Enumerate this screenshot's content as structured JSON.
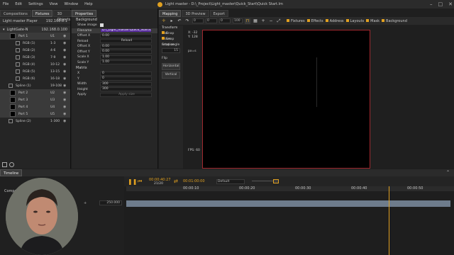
{
  "menu": [
    "File",
    "Edit",
    "Settings",
    "View",
    "Window",
    "Help"
  ],
  "window": {
    "title": "Light master - D:\\_Project\\Light_master\\Quick_Start\\Quick Start.lm",
    "controls": [
      "–",
      "□",
      "✕"
    ]
  },
  "left_tabs": [
    "Compositions",
    "Fixtures",
    "3D Objects"
  ],
  "device": {
    "name": "Light master Player",
    "ip": "192.168.0.1"
  },
  "controller": {
    "name": "LightGate-N",
    "ip": "192.168.0.100"
  },
  "tree": [
    {
      "label": "Port 1",
      "ch": "U1"
    },
    {
      "label": "RGB (1)",
      "ch": "1-3"
    },
    {
      "label": "RGB (2)",
      "ch": "4-6"
    },
    {
      "label": "RGB (3)",
      "ch": "7-9"
    },
    {
      "label": "RGB (4)",
      "ch": "10-12"
    },
    {
      "label": "RGB (5)",
      "ch": "13-15"
    },
    {
      "label": "RGB (6)",
      "ch": "16-18"
    },
    {
      "label": "Spline (1)",
      "ch": "19-108"
    },
    {
      "label": "Port 2",
      "ch": "U2"
    },
    {
      "label": "Port 3",
      "ch": "U3"
    },
    {
      "label": "Port 4",
      "ch": "U4"
    },
    {
      "label": "Port 5",
      "ch": "U5"
    },
    {
      "label": "Spline (2)",
      "ch": "1-300"
    }
  ],
  "props": {
    "tab": "Properties",
    "background": "Background",
    "show_image": "Show image",
    "filename_label": "Filename",
    "filename_value": "D:\\_Light_master\\Quick_Start\\Quick Start.jpg",
    "offset_x_label": "Offset X",
    "offset_x": "0.00",
    "reload_label": "Reload",
    "reload_btn": "Reload",
    "offset_x2_label": "Offset X",
    "offset_x2": "0.00",
    "offset_y_label": "Offset Y",
    "offset_y": "0.00",
    "scale_x_label": "Scale X",
    "scale_x": "1.00",
    "scale_y_label": "Scale Y",
    "scale_y": "1.00",
    "matrix": "Matrix",
    "x_label": "X",
    "x": "0",
    "y_label": "Y",
    "y": "0",
    "width_label": "Width",
    "width": "300",
    "height_label": "Height",
    "height": "300",
    "apply_label": "Apply",
    "apply_btn": "Apply size"
  },
  "mapping_tabs": [
    "Mapping",
    "3D Preview",
    "Export"
  ],
  "toolbar": {
    "x": "0",
    "y": "0",
    "z": "0",
    "zoom": "100",
    "filters": [
      "Fixtures",
      "Effects",
      "Address",
      "Layouts",
      "Mask",
      "Background"
    ]
  },
  "transform": {
    "title": "Transform tool",
    "snap_move": "Snap move",
    "snap_rotation": "Snap rotation",
    "snap_angle_label": "Snap angle",
    "snap_angle": "15",
    "flip": "Flip",
    "horizontal": "Horizontal",
    "vertical": "Vertical"
  },
  "canvas": {
    "coords": [
      "X: -32",
      "Y: 128"
    ],
    "px_label": "px=s",
    "fps": "FPS: 60"
  },
  "timeline": {
    "tab": "Timeline",
    "time": "00:00:40:27",
    "frame": "21/20",
    "duration": "00:01:00:00",
    "preset": "Default",
    "ruler": [
      "00:00:10",
      "00:00:20",
      "00:00:30",
      "00:00:40",
      "00:00:50"
    ],
    "layer_label": "Compo",
    "value": "250.000"
  },
  "colors": {
    "accent": "#e0a020",
    "canvas_border": "#a0282e",
    "track": "#6e7c8c"
  }
}
